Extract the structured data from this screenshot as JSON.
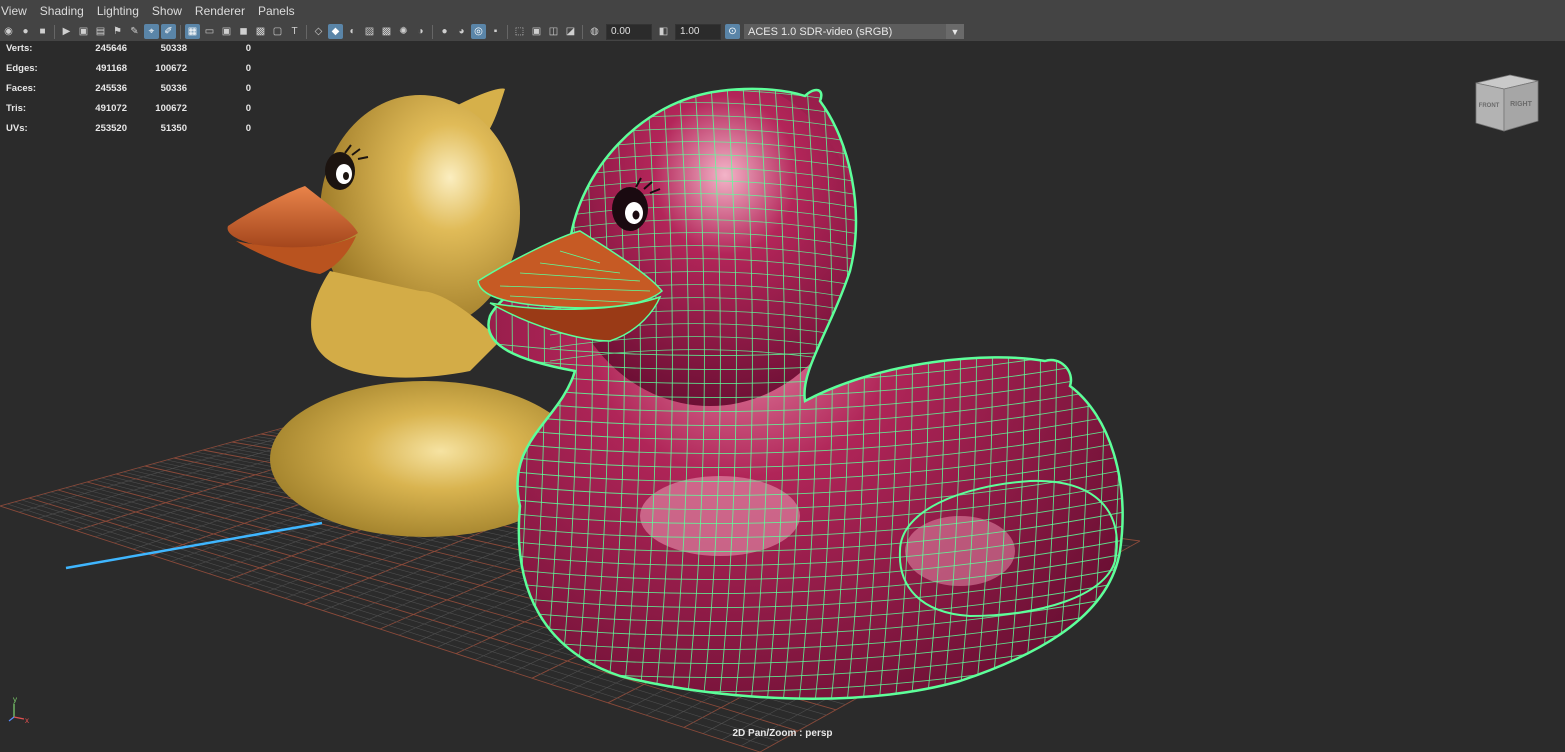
{
  "menubar": {
    "items": [
      "View",
      "Shading",
      "Lighting",
      "Show",
      "Renderer",
      "Panels"
    ]
  },
  "toolbar": {
    "exposure_value": "0.00",
    "gamma_value": "1.00",
    "colorspace_selected": "ACES 1.0 SDR-video (sRGB)",
    "icons": [
      "select-camera-icon",
      "camera-attributes-icon",
      "bookmarks-icon",
      "image-plane-icon",
      "grid-icon",
      "film-gate-icon",
      "resolution-gate-icon",
      "safe-action-icon",
      "wireframe-icon",
      "smooth-shade-icon",
      "textured-icon",
      "lights-icon",
      "shadows-icon",
      "ambient-occlusion-icon",
      "isolate-select-icon",
      "xray-icon",
      "exposure-icon",
      "gamma-icon",
      "color-management-icon"
    ]
  },
  "hud": {
    "rows": [
      {
        "label": "Verts:",
        "v1": "245646",
        "v2": "50338",
        "v3": "0"
      },
      {
        "label": "Edges:",
        "v1": "491168",
        "v2": "100672",
        "v3": "0"
      },
      {
        "label": "Faces:",
        "v1": "245536",
        "v2": "50336",
        "v3": "0"
      },
      {
        "label": "Tris:",
        "v1": "491072",
        "v2": "100672",
        "v3": "0"
      },
      {
        "label": "UVs:",
        "v1": "253520",
        "v2": "51350",
        "v3": "0"
      }
    ]
  },
  "viewcube": {
    "front_label": "FRONT",
    "right_label": "RIGHT"
  },
  "axis": {
    "y_label": "y",
    "x_label": "x"
  },
  "camera_label": "2D Pan/Zoom : persp",
  "colors": {
    "viewport_bg": "#2b2b2b",
    "wire_selected": "#5dff9a",
    "duck_yellow": "#d8b350",
    "duck_pink": "#a31a52",
    "beak_orange": "#d2692a",
    "grid_axis": "#c05a3a",
    "x_axis_line": "#3fb6ff"
  }
}
